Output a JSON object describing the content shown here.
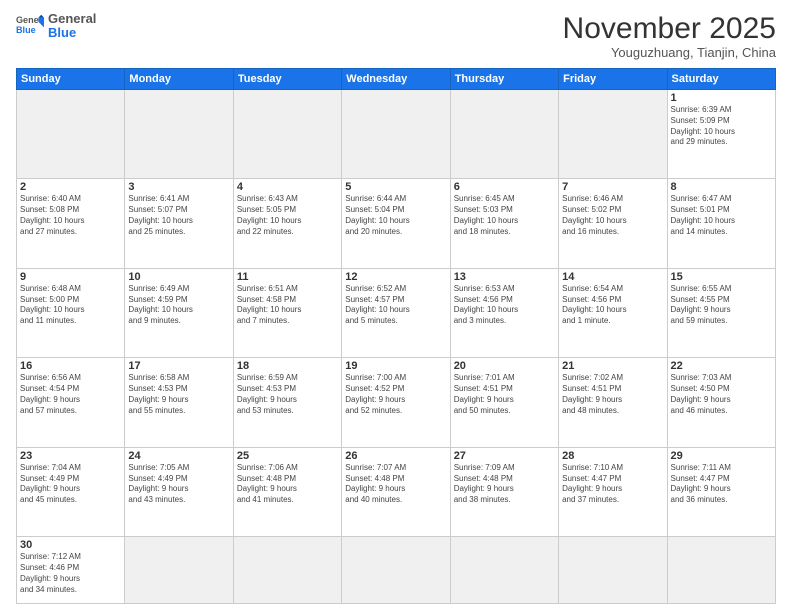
{
  "header": {
    "logo_general": "General",
    "logo_blue": "Blue",
    "month": "November 2025",
    "location": "Youguzhuang, Tianjin, China"
  },
  "weekdays": [
    "Sunday",
    "Monday",
    "Tuesday",
    "Wednesday",
    "Thursday",
    "Friday",
    "Saturday"
  ],
  "weeks": [
    [
      {
        "num": "",
        "info": ""
      },
      {
        "num": "",
        "info": ""
      },
      {
        "num": "",
        "info": ""
      },
      {
        "num": "",
        "info": ""
      },
      {
        "num": "",
        "info": ""
      },
      {
        "num": "",
        "info": ""
      },
      {
        "num": "1",
        "info": "Sunrise: 6:39 AM\nSunset: 5:09 PM\nDaylight: 10 hours\nand 29 minutes."
      }
    ],
    [
      {
        "num": "2",
        "info": "Sunrise: 6:40 AM\nSunset: 5:08 PM\nDaylight: 10 hours\nand 27 minutes."
      },
      {
        "num": "3",
        "info": "Sunrise: 6:41 AM\nSunset: 5:07 PM\nDaylight: 10 hours\nand 25 minutes."
      },
      {
        "num": "4",
        "info": "Sunrise: 6:43 AM\nSunset: 5:05 PM\nDaylight: 10 hours\nand 22 minutes."
      },
      {
        "num": "5",
        "info": "Sunrise: 6:44 AM\nSunset: 5:04 PM\nDaylight: 10 hours\nand 20 minutes."
      },
      {
        "num": "6",
        "info": "Sunrise: 6:45 AM\nSunset: 5:03 PM\nDaylight: 10 hours\nand 18 minutes."
      },
      {
        "num": "7",
        "info": "Sunrise: 6:46 AM\nSunset: 5:02 PM\nDaylight: 10 hours\nand 16 minutes."
      },
      {
        "num": "8",
        "info": "Sunrise: 6:47 AM\nSunset: 5:01 PM\nDaylight: 10 hours\nand 14 minutes."
      }
    ],
    [
      {
        "num": "9",
        "info": "Sunrise: 6:48 AM\nSunset: 5:00 PM\nDaylight: 10 hours\nand 11 minutes."
      },
      {
        "num": "10",
        "info": "Sunrise: 6:49 AM\nSunset: 4:59 PM\nDaylight: 10 hours\nand 9 minutes."
      },
      {
        "num": "11",
        "info": "Sunrise: 6:51 AM\nSunset: 4:58 PM\nDaylight: 10 hours\nand 7 minutes."
      },
      {
        "num": "12",
        "info": "Sunrise: 6:52 AM\nSunset: 4:57 PM\nDaylight: 10 hours\nand 5 minutes."
      },
      {
        "num": "13",
        "info": "Sunrise: 6:53 AM\nSunset: 4:56 PM\nDaylight: 10 hours\nand 3 minutes."
      },
      {
        "num": "14",
        "info": "Sunrise: 6:54 AM\nSunset: 4:56 PM\nDaylight: 10 hours\nand 1 minute."
      },
      {
        "num": "15",
        "info": "Sunrise: 6:55 AM\nSunset: 4:55 PM\nDaylight: 9 hours\nand 59 minutes."
      }
    ],
    [
      {
        "num": "16",
        "info": "Sunrise: 6:56 AM\nSunset: 4:54 PM\nDaylight: 9 hours\nand 57 minutes."
      },
      {
        "num": "17",
        "info": "Sunrise: 6:58 AM\nSunset: 4:53 PM\nDaylight: 9 hours\nand 55 minutes."
      },
      {
        "num": "18",
        "info": "Sunrise: 6:59 AM\nSunset: 4:53 PM\nDaylight: 9 hours\nand 53 minutes."
      },
      {
        "num": "19",
        "info": "Sunrise: 7:00 AM\nSunset: 4:52 PM\nDaylight: 9 hours\nand 52 minutes."
      },
      {
        "num": "20",
        "info": "Sunrise: 7:01 AM\nSunset: 4:51 PM\nDaylight: 9 hours\nand 50 minutes."
      },
      {
        "num": "21",
        "info": "Sunrise: 7:02 AM\nSunset: 4:51 PM\nDaylight: 9 hours\nand 48 minutes."
      },
      {
        "num": "22",
        "info": "Sunrise: 7:03 AM\nSunset: 4:50 PM\nDaylight: 9 hours\nand 46 minutes."
      }
    ],
    [
      {
        "num": "23",
        "info": "Sunrise: 7:04 AM\nSunset: 4:49 PM\nDaylight: 9 hours\nand 45 minutes."
      },
      {
        "num": "24",
        "info": "Sunrise: 7:05 AM\nSunset: 4:49 PM\nDaylight: 9 hours\nand 43 minutes."
      },
      {
        "num": "25",
        "info": "Sunrise: 7:06 AM\nSunset: 4:48 PM\nDaylight: 9 hours\nand 41 minutes."
      },
      {
        "num": "26",
        "info": "Sunrise: 7:07 AM\nSunset: 4:48 PM\nDaylight: 9 hours\nand 40 minutes."
      },
      {
        "num": "27",
        "info": "Sunrise: 7:09 AM\nSunset: 4:48 PM\nDaylight: 9 hours\nand 38 minutes."
      },
      {
        "num": "28",
        "info": "Sunrise: 7:10 AM\nSunset: 4:47 PM\nDaylight: 9 hours\nand 37 minutes."
      },
      {
        "num": "29",
        "info": "Sunrise: 7:11 AM\nSunset: 4:47 PM\nDaylight: 9 hours\nand 36 minutes."
      }
    ],
    [
      {
        "num": "30",
        "info": "Sunrise: 7:12 AM\nSunset: 4:46 PM\nDaylight: 9 hours\nand 34 minutes."
      },
      {
        "num": "",
        "info": ""
      },
      {
        "num": "",
        "info": ""
      },
      {
        "num": "",
        "info": ""
      },
      {
        "num": "",
        "info": ""
      },
      {
        "num": "",
        "info": ""
      },
      {
        "num": "",
        "info": ""
      }
    ]
  ]
}
